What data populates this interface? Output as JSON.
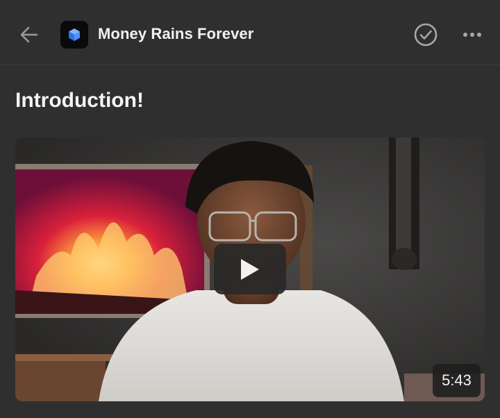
{
  "header": {
    "back_icon": "arrow-left-icon",
    "app_logo_icon": "cube-icon",
    "title": "Money Rains Forever",
    "complete_icon": "check-circle-icon",
    "more_icon": "more-horizontal-icon"
  },
  "lesson": {
    "title": "Introduction!"
  },
  "video": {
    "play_icon": "play-icon",
    "duration": "5:43"
  },
  "colors": {
    "background": "#2f2f2f",
    "logo_bg": "#0a0a0a",
    "logo_accent": "#3d8bff"
  }
}
